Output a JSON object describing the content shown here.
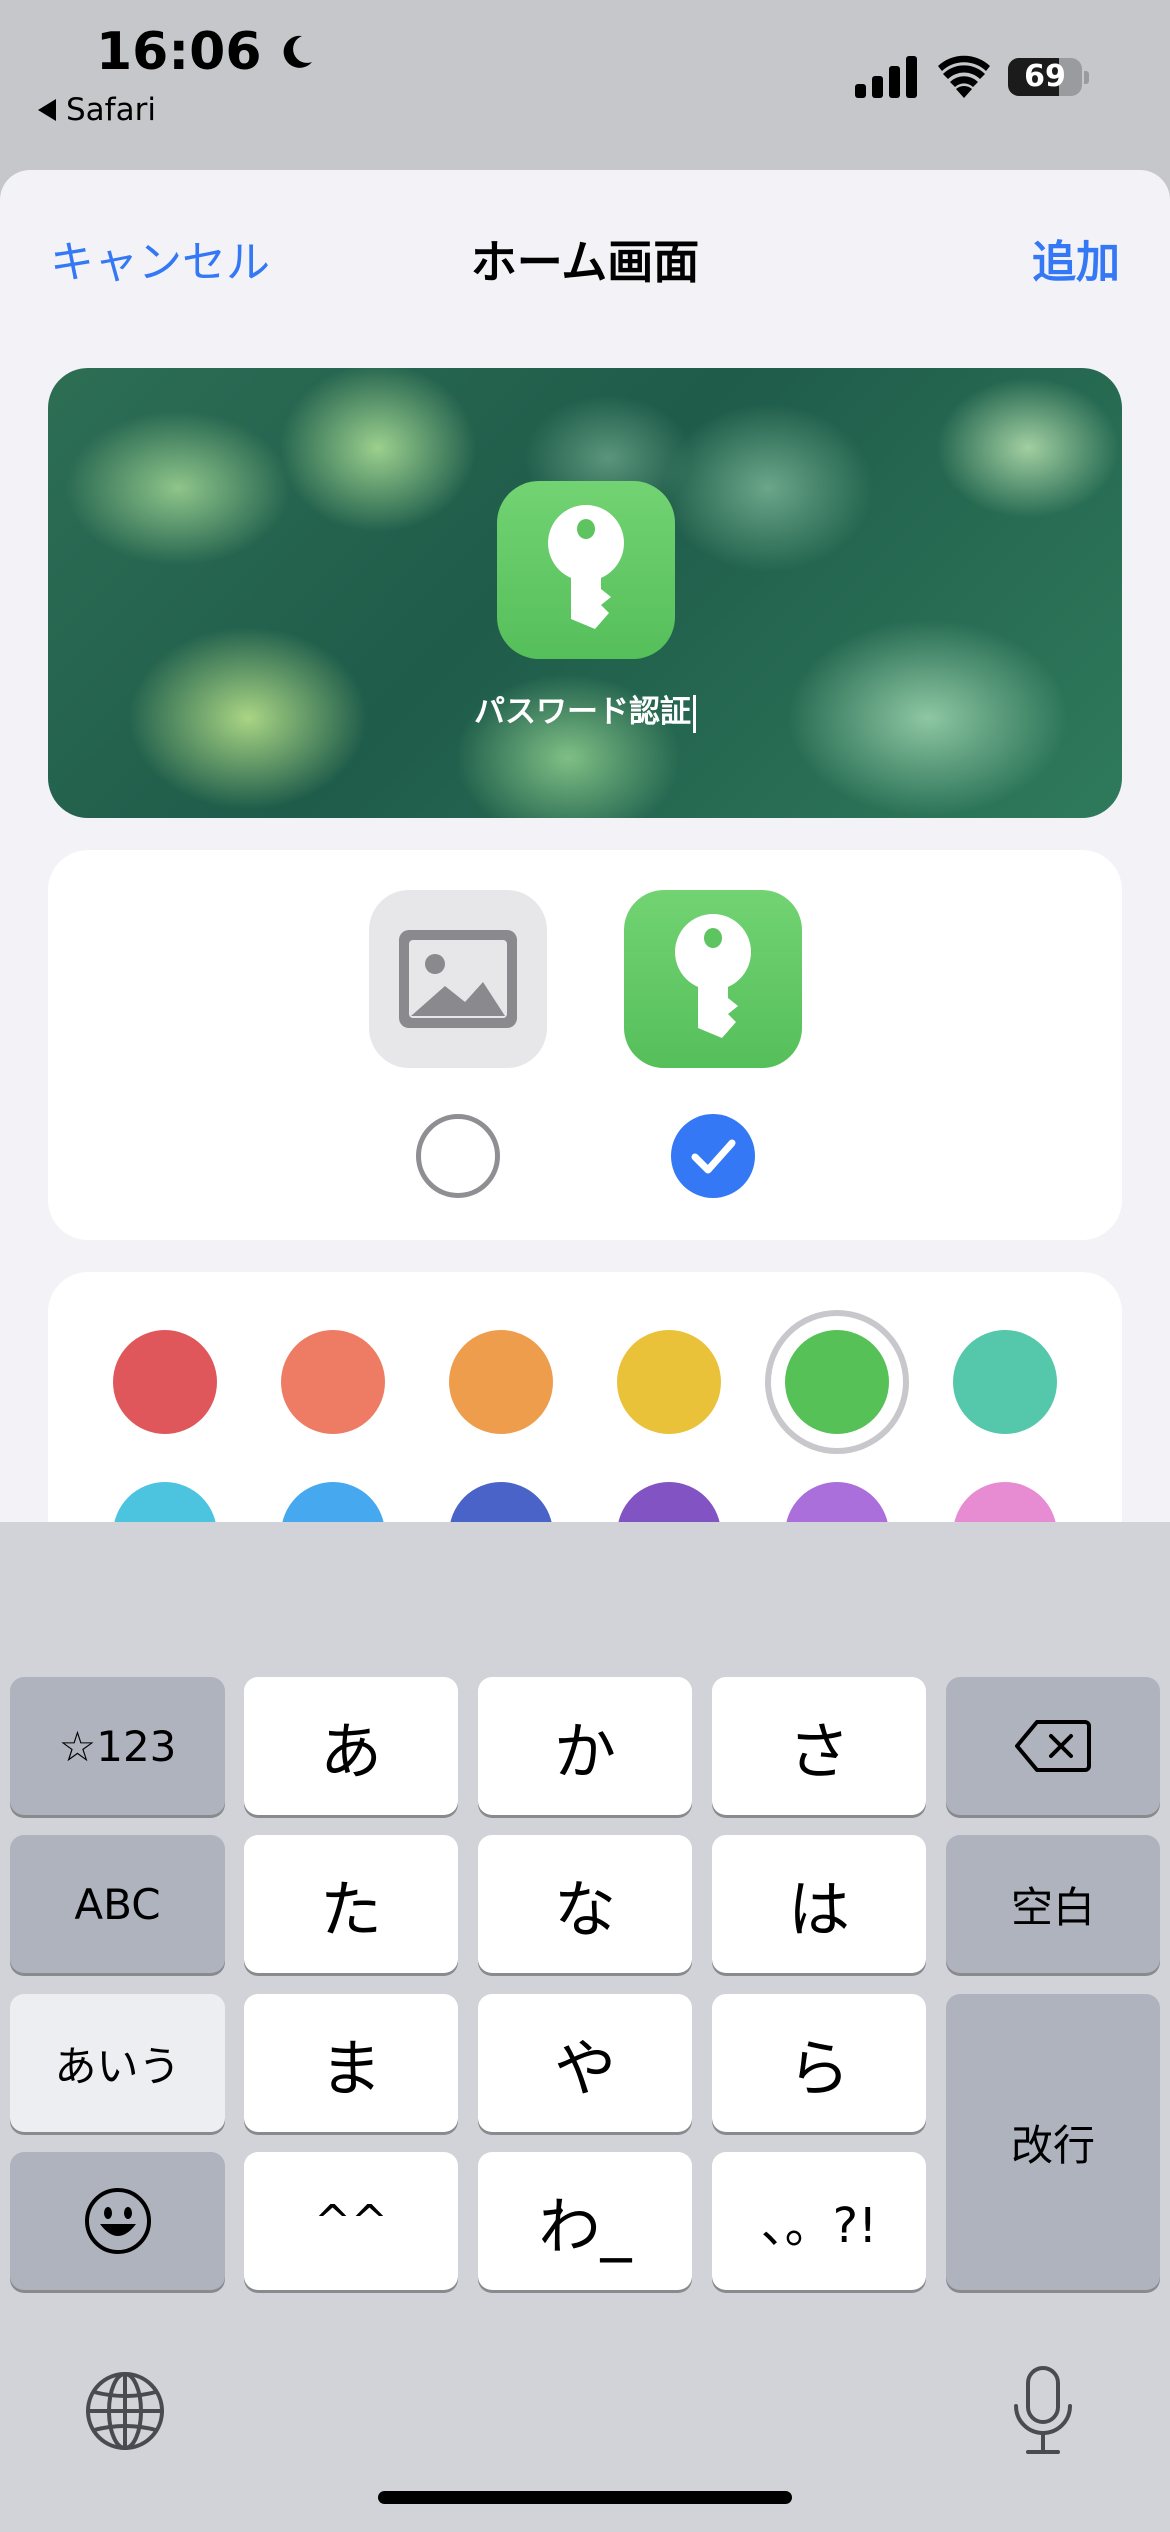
{
  "status_bar": {
    "time": "16:06",
    "focus_icon": "moon-icon",
    "back_app": "Safari",
    "signal_icon": "cellular-signal-icon",
    "wifi_icon": "wifi-icon",
    "battery_percent": "69",
    "battery_level": 0.69
  },
  "nav": {
    "cancel": "キャンセル",
    "title": "ホーム画面",
    "add": "追加"
  },
  "preview": {
    "app_icon": "key-icon",
    "app_name": "パスワード認証"
  },
  "icon_choice": {
    "options": [
      {
        "icon": "photo-icon",
        "selected": false
      },
      {
        "icon": "key-icon",
        "selected": true
      }
    ]
  },
  "colors": {
    "row1": [
      "#e0575b",
      "#ee7b64",
      "#ee9d4d",
      "#e9c23a",
      "#56c157",
      "#55c7ab"
    ],
    "row2": [
      "#4cc4e0",
      "#46a8ef",
      "#4a63c8",
      "#8253c2",
      "#ab6fdb",
      "#e78bd3"
    ],
    "selected": "#56c157",
    "selected_index": 4
  },
  "keyboard": {
    "mode_key": "☆123",
    "abc_key": "ABC",
    "kana_key": "あいう",
    "emoji_icon": "emoji-icon",
    "row1": [
      "あ",
      "か",
      "さ"
    ],
    "row2": [
      "た",
      "な",
      "は"
    ],
    "row3": [
      "ま",
      "や",
      "ら"
    ],
    "row4": [
      "^^",
      "わ_",
      "、。?!"
    ],
    "backspace_icon": "backspace-icon",
    "space": "空白",
    "return": "改行",
    "globe_icon": "globe-icon",
    "mic_icon": "microphone-icon"
  }
}
